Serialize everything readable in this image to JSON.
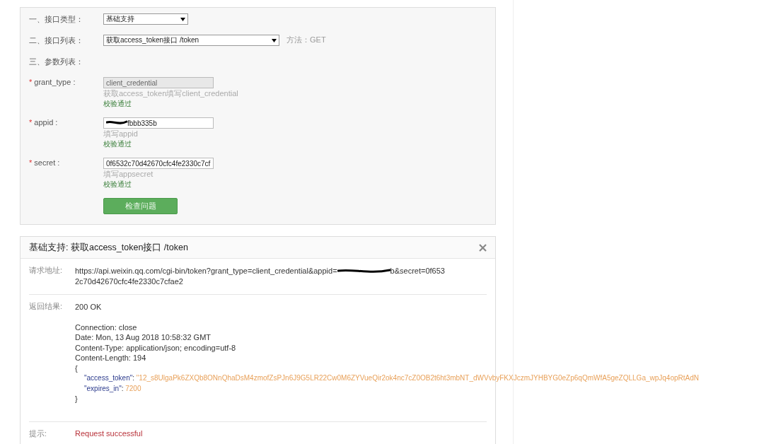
{
  "form": {
    "interface_type": {
      "label": "一、接口类型：",
      "value": "基础支持"
    },
    "interface_list": {
      "label": "二、接口列表：",
      "value": "获取access_token接口 /token",
      "method": "方法：GET"
    },
    "params_heading": "三、参数列表：",
    "params": [
      {
        "required_mark": "*",
        "label": "grant_type :",
        "value": "client_credential",
        "disabled": true,
        "redacted": false,
        "hint": "获取access_token填写client_credential",
        "validation": "校验通过"
      },
      {
        "required_mark": "*",
        "label": "appid :",
        "value": "fbbb335b",
        "disabled": false,
        "redacted": true,
        "hint": "填写appid",
        "validation": "校验通过"
      },
      {
        "required_mark": "*",
        "label": "secret :",
        "value": "0f6532c70d42670cfc4fe2330c7cf",
        "disabled": false,
        "redacted": false,
        "hint": "填写appsecret",
        "validation": "校验通过"
      }
    ],
    "submit_button": "检查问题"
  },
  "result": {
    "title": "基础支持: 获取access_token接口 /token",
    "request": {
      "label": "请求地址:",
      "url_start": "https://api.weixin.qq.com/cgi-bin/token?grant_type=client_credential&appid=",
      "url_after_redaction": "b&secret=0f653",
      "url_continued": "2c70d42670cfc4fe2330c7cfae2"
    },
    "response": {
      "label": "返回结果:",
      "status": "200 OK",
      "headers": [
        "Connection: close",
        "Date: Mon, 13 Aug 2018 10:58:32 GMT",
        "Content-Type: application/json; encoding=utf-8",
        "Content-Length: 194"
      ],
      "open_brace": "{",
      "fields": [
        {
          "key": "\"access_token\"",
          "colon": ": ",
          "value": "\"12_s8UlgaPk6ZXQb8ONnQhaDsM4zmofZsPJn6J9G5LR22Cw0M6ZYVueQir2ok4nc7cZ0OB2t6ht3mbNT_dWVvbyFKXJczmJYHBYG0eZp6qQmWfA5geZQLLGa_wpJq4opRtAdN"
        },
        {
          "key": "\"expires_in\"",
          "colon": ": ",
          "value": "7200"
        }
      ],
      "close_brace": "}"
    },
    "tip": {
      "label": "提示:",
      "message": "Request successful"
    }
  }
}
